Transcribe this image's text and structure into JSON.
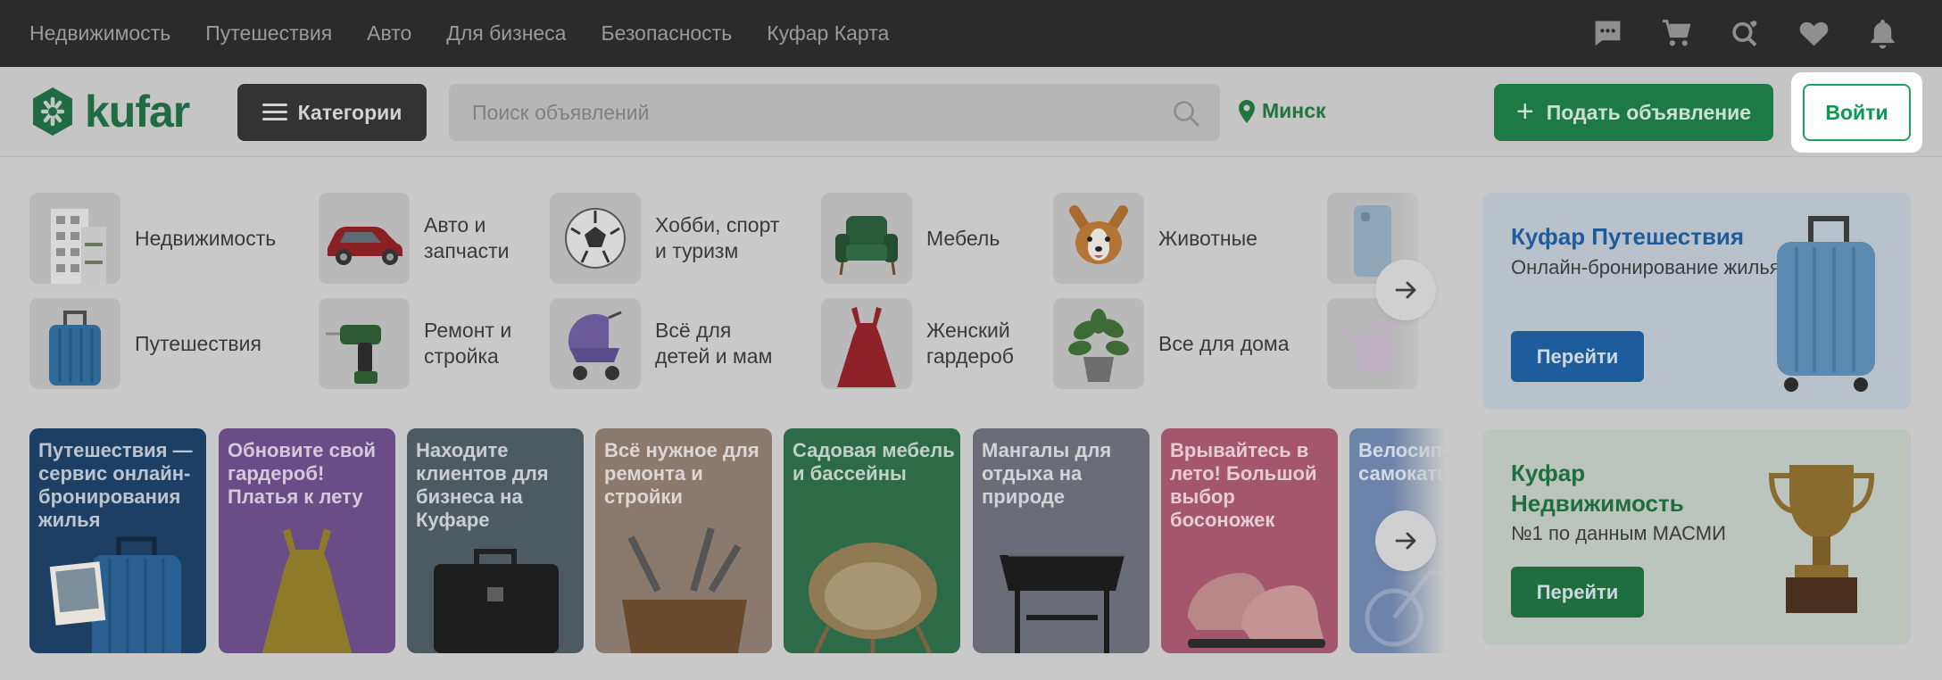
{
  "topbar": {
    "links": [
      "Недвижимость",
      "Путешествия",
      "Авто",
      "Для бизнеса",
      "Безопасность",
      "Куфар Карта"
    ],
    "icons": [
      "chat-icon",
      "cart-icon",
      "search-favorites-icon",
      "heart-icon",
      "bell-icon"
    ]
  },
  "header": {
    "logo_text": "kufar",
    "categories_label": "Категории",
    "search_placeholder": "Поиск объявлений",
    "location": "Минск",
    "post_label": "Подать объявление",
    "login_label": "Войти"
  },
  "categories": [
    {
      "label": "Недвижимость",
      "icon": "building"
    },
    {
      "label": "Авто и запчасти",
      "icon": "car"
    },
    {
      "label": "Хобби, спорт и туризм",
      "icon": "ball"
    },
    {
      "label": "Мебель",
      "icon": "armchair"
    },
    {
      "label": "Животные",
      "icon": "dog"
    },
    {
      "label": "Путешествия",
      "icon": "suitcase"
    },
    {
      "label": "Ремонт и стройка",
      "icon": "drill"
    },
    {
      "label": "Всё для детей и мам",
      "icon": "stroller"
    },
    {
      "label": "Женский гардероб",
      "icon": "dress"
    },
    {
      "label": "Все для дома",
      "icon": "plant"
    }
  ],
  "banners": [
    {
      "text": "Путешествия — сервис онлайн-бронирования жилья",
      "color": "#1d3f63"
    },
    {
      "text": "Обновите свой гардероб! Платья к лету",
      "color": "#6a4c86"
    },
    {
      "text": "Находите клиентов для бизнеса на Куфаре",
      "color": "#4e5a62"
    },
    {
      "text": "Всё нужное для ремонта и стройки",
      "color": "#8a7a6e"
    },
    {
      "text": "Садовая мебель и бассейны",
      "color": "#2c6a48"
    },
    {
      "text": "Мангалы для отдыха на природе",
      "color": "#6a6d78"
    },
    {
      "text": "Врывайтесь в лето! Большой выбор босоножек",
      "color": "#a5566f"
    },
    {
      "text": "Велосипеды самокаты деток",
      "color": "#6d84aa"
    }
  ],
  "promos": [
    {
      "title": "Куфар Путешествия",
      "subtitle": "Онлайн-бронирование жилья",
      "button": "Перейти",
      "title_color": "#1f5c9c",
      "button_color": "#1f5c9c"
    },
    {
      "title": "Куфар Недвижимость",
      "subtitle": "№1 по данным МАСМИ",
      "button": "Перейти",
      "title_color": "#1e6e40",
      "button_color": "#1e6e40"
    }
  ],
  "colors": {
    "brand": "#0a9a4d",
    "topbar": "#2b2b2b",
    "overlay": "#c9c9c9"
  }
}
